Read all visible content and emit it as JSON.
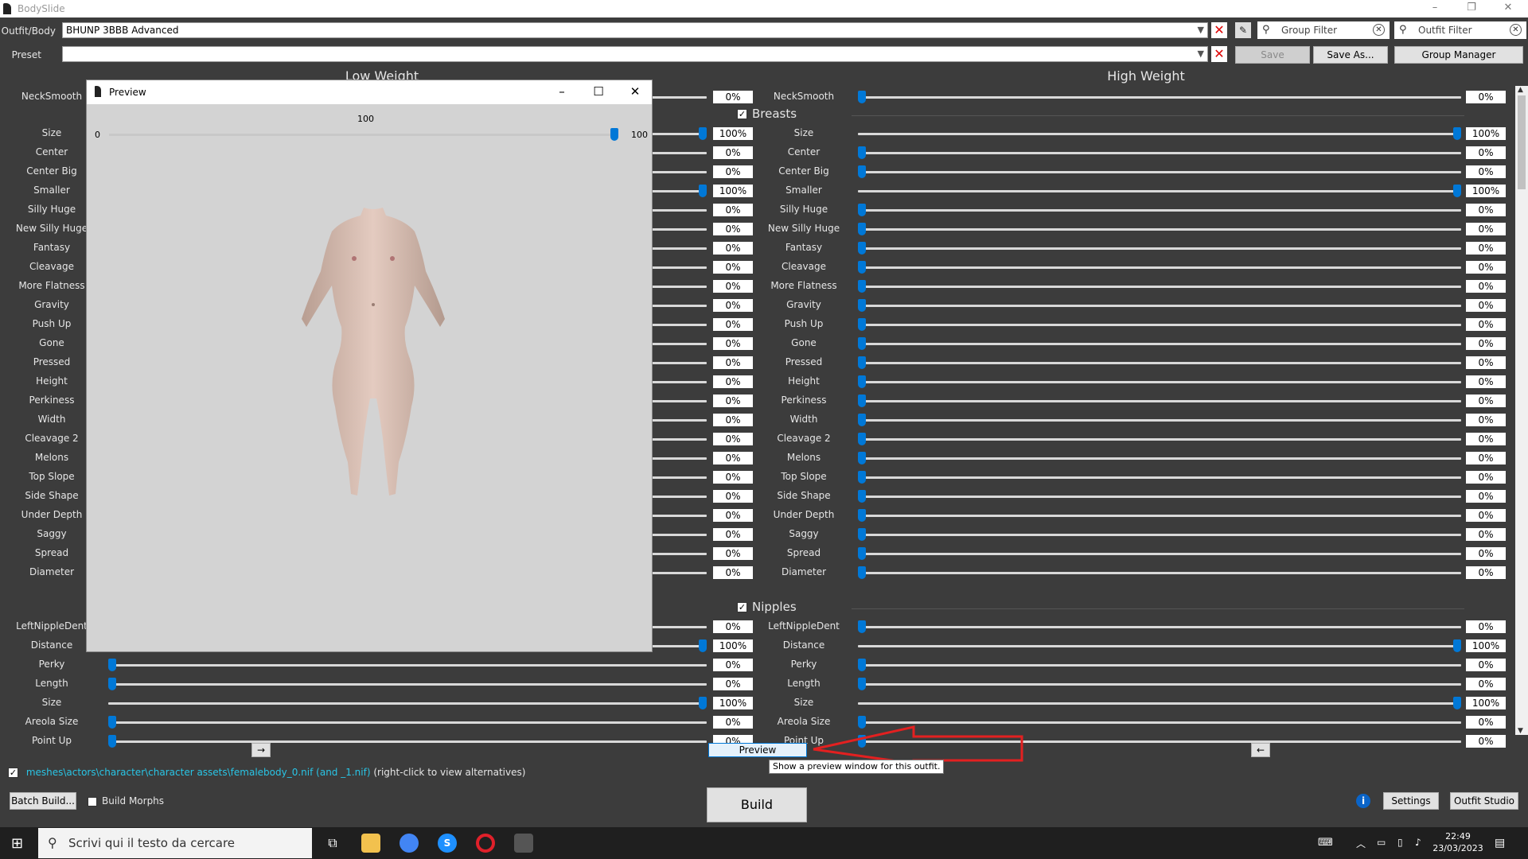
{
  "window": {
    "title": "BodySlide",
    "min": "–",
    "max": "❐",
    "close": "✕"
  },
  "outfit": {
    "label": "Outfit/Body",
    "value": "BHUNP 3BBB Advanced"
  },
  "preset": {
    "label": "Preset",
    "value": ""
  },
  "filters": {
    "group": "Group Filter",
    "outfit": "Outfit Filter"
  },
  "buttons": {
    "save": "Save",
    "save_as": "Save As...",
    "group_manager": "Group Manager",
    "batch_build": "Batch Build...",
    "build_morphs": "Build Morphs",
    "build": "Build",
    "preview": "Preview",
    "settings": "Settings",
    "outfit_studio": "Outfit Studio",
    "copy_right": "→",
    "copy_left": "←",
    "info": "i"
  },
  "columns": {
    "low": "Low Weight",
    "high": "High Weight"
  },
  "top_slider": {
    "label": "NeckSmooth",
    "low": 0,
    "high": 0
  },
  "groups": [
    {
      "name": "Breasts",
      "checked": true,
      "sliders": [
        {
          "label": "Size",
          "low": 100,
          "high": 100
        },
        {
          "label": "Center",
          "low": 0,
          "high": 0
        },
        {
          "label": "Center Big",
          "low": 0,
          "high": 0
        },
        {
          "label": "Smaller",
          "low": 100,
          "high": 100
        },
        {
          "label": "Silly Huge",
          "low": 0,
          "high": 0
        },
        {
          "label": "New Silly Huge",
          "low": 0,
          "high": 0
        },
        {
          "label": "Fantasy",
          "low": 0,
          "high": 0
        },
        {
          "label": "Cleavage",
          "low": 0,
          "high": 0
        },
        {
          "label": "More Flatness",
          "low": 0,
          "high": 0
        },
        {
          "label": "Gravity",
          "low": 0,
          "high": 0
        },
        {
          "label": "Push Up",
          "low": 0,
          "high": 0
        },
        {
          "label": "Gone",
          "low": 0,
          "high": 0
        },
        {
          "label": "Pressed",
          "low": 0,
          "high": 0
        },
        {
          "label": "Height",
          "low": 0,
          "high": 0
        },
        {
          "label": "Perkiness",
          "low": 0,
          "high": 0
        },
        {
          "label": "Width",
          "low": 0,
          "high": 0
        },
        {
          "label": "Cleavage 2",
          "low": 0,
          "high": 0
        },
        {
          "label": "Melons",
          "low": 0,
          "high": 0
        },
        {
          "label": "Top Slope",
          "low": 0,
          "high": 0
        },
        {
          "label": "Side Shape",
          "low": 0,
          "high": 0
        },
        {
          "label": "Under Depth",
          "low": 0,
          "high": 0
        },
        {
          "label": "Saggy",
          "low": 0,
          "high": 0
        },
        {
          "label": "Spread",
          "low": 0,
          "high": 0
        },
        {
          "label": "Diameter",
          "low": 0,
          "high": 0
        }
      ]
    },
    {
      "name": "Nipples",
      "checked": true,
      "sliders": [
        {
          "label": "LeftNippleDent",
          "low": 0,
          "high": 0
        },
        {
          "label": "Distance",
          "low": 100,
          "high": 100
        },
        {
          "label": "Perky",
          "low": 0,
          "high": 0
        },
        {
          "label": "Length",
          "low": 0,
          "high": 0
        },
        {
          "label": "Size",
          "low": 100,
          "high": 100
        },
        {
          "label": "Areola Size",
          "low": 0,
          "high": 0
        },
        {
          "label": "Point Up",
          "low": 0,
          "high": 0
        }
      ]
    }
  ],
  "preview_window": {
    "title": "Preview",
    "slider_min": "0",
    "slider_max": "100",
    "slider_value": "100",
    "slider_fraction": 1.0
  },
  "path": {
    "value": "meshes\\actors\\character\\character assets\\femalebody_0.nif (and _1.nif)",
    "hint": "(right-click to view alternatives)"
  },
  "tooltip": "Show a preview window for this outfit.",
  "taskbar": {
    "search_placeholder": "Scrivi qui il testo da cercare",
    "time": "22:49",
    "date": "23/03/2023"
  }
}
